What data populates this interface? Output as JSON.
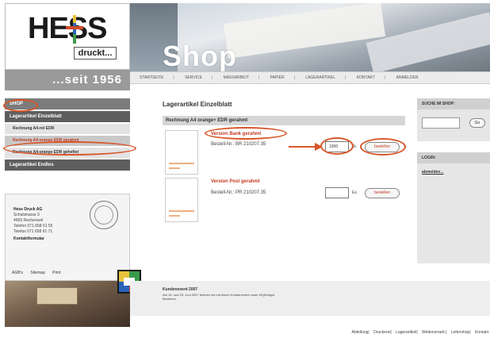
{
  "brand": {
    "logo_text": "HESS",
    "logo_sub": "druckt...",
    "since": "...seit 1956"
  },
  "header": {
    "title": "Shop"
  },
  "top_nav": [
    "STARTSEITE",
    "SERVICE",
    "MASSARBEIT",
    "PAPIER",
    "LAGERARTIKEL",
    "KONTAKT",
    "ANMELDEN"
  ],
  "left_nav": {
    "shop_label": "SHOP",
    "group1": "Lagerartikel Einzelblatt",
    "sub1": "Rechnung A4-rot EDR",
    "sub2": "Rechnung A4-orange EDR gerahmt",
    "sub3": "Rechnung A4-orange EDR geheftet",
    "group2": "Lagerartikel Endlos"
  },
  "address": {
    "company": "Hess Druck AG",
    "street": "Schulstrasse 3",
    "city": "4565 Recherswil",
    "phone": "Telefon 071 658 61 55",
    "fax": "Telefax 071 658 61 71",
    "form_link": "Kontaktformular"
  },
  "left_footer": [
    "AGB's",
    "Sitemap",
    "Print"
  ],
  "main": {
    "title": "Lagerartikel Einzelblatt",
    "product_bar": "Rechnung A4 orange+ EDR gerahmt",
    "items": [
      {
        "variant": "Version Bank gerahmt",
        "order_no": "Bestell-Nr.: BR 210207.35",
        "qty": "1000",
        "unit": "St.",
        "button": "bestellen"
      },
      {
        "variant": "Version Post gerahmt",
        "order_no": "Bestell-Nr.: PR 210207.35",
        "qty": "",
        "unit": "Ex.",
        "button": "bestellen"
      }
    ]
  },
  "right": {
    "search_head": "SUCHE IM SHOP:",
    "search_btn": "Go",
    "login_head": "LOGIN:",
    "login_link": "abmelden..."
  },
  "news": {
    "title": "Kundenevent 2007",
    "text": "Am 16. und 23. Juni 2007 feierten wir mit einem Kundenevent unser 50-jähriges Bestehen."
  },
  "footer_links": [
    "Abteilung",
    "Druckerei",
    "Lagerartikel",
    "Weiterverarb.",
    "Lettershop",
    "Kontakt"
  ],
  "colors": {
    "accent": "#d8572a",
    "nav_dark": "#5e5e5e",
    "nav_mid": "#7c7c7c",
    "alert_text": "#c03a20"
  }
}
